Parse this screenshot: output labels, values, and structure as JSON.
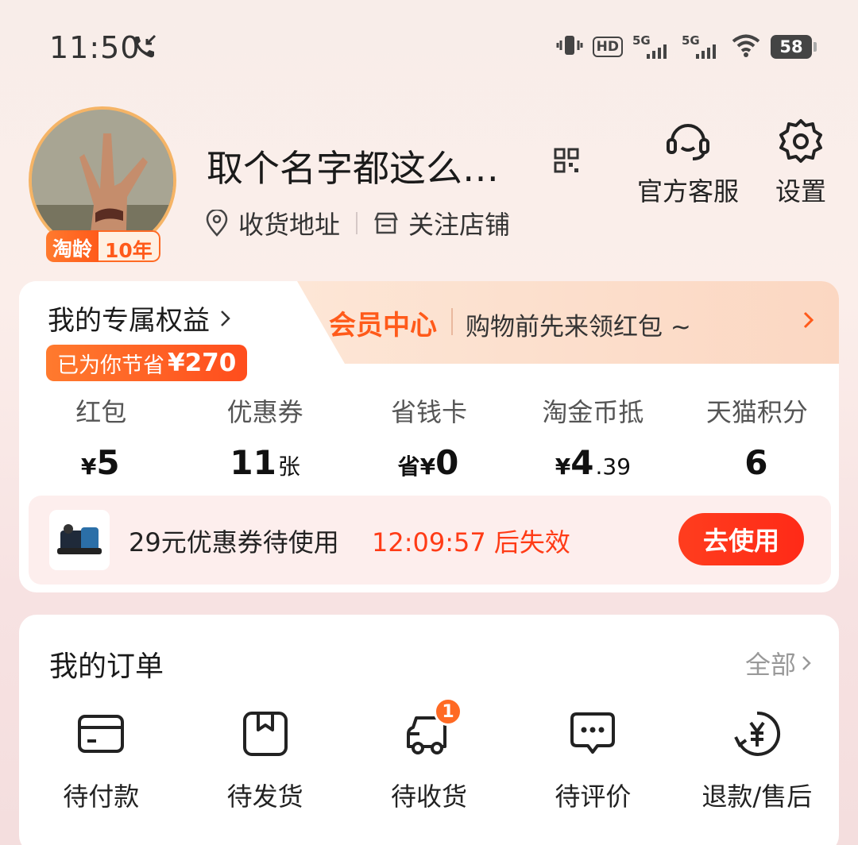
{
  "status_bar": {
    "time": "11:50",
    "hd_label": "HD",
    "network_1": "5G",
    "network_2": "5G",
    "battery": "58"
  },
  "profile": {
    "username": "取个名字都这么…",
    "age_badge_label": "淘龄",
    "age_badge_value": "10年",
    "address_label": "收货地址",
    "followed_shops_label": "关注店铺",
    "customer_service_label": "官方客服",
    "settings_label": "设置"
  },
  "benefits": {
    "title": "我的专属权益",
    "saved_label": "已为你节省",
    "saved_amount": "¥270",
    "member_center": "会员中心",
    "member_tip": "购物前先来领红包 ~",
    "stats": [
      {
        "label": "红包",
        "prefix": "¥",
        "value": "5",
        "suffix": ""
      },
      {
        "label": "优惠券",
        "prefix": "",
        "value": "11",
        "suffix": "张"
      },
      {
        "label": "省钱卡",
        "prefix": "省¥",
        "value": "0",
        "suffix": ""
      },
      {
        "label": "淘金币抵",
        "prefix": "¥",
        "value": "4",
        "suffix": ".39"
      },
      {
        "label": "天猫积分",
        "prefix": "",
        "value": "6",
        "suffix": ""
      }
    ],
    "coupon": {
      "text": "29元优惠券待使用",
      "timer": "12:09:57 后失效",
      "button": "去使用"
    }
  },
  "orders": {
    "title": "我的订单",
    "all_label": "全部",
    "items": [
      {
        "label": "待付款",
        "icon": "card-icon"
      },
      {
        "label": "待发货",
        "icon": "package-icon"
      },
      {
        "label": "待收货",
        "icon": "truck-icon",
        "badge": "1"
      },
      {
        "label": "待评价",
        "icon": "comment-icon"
      },
      {
        "label": "退款/售后",
        "icon": "refund-icon"
      }
    ]
  },
  "colors": {
    "accent": "#ff5a1a",
    "button_red": "#ff2a17",
    "timer_red": "#ff3b16",
    "muted_text": "#999999"
  }
}
